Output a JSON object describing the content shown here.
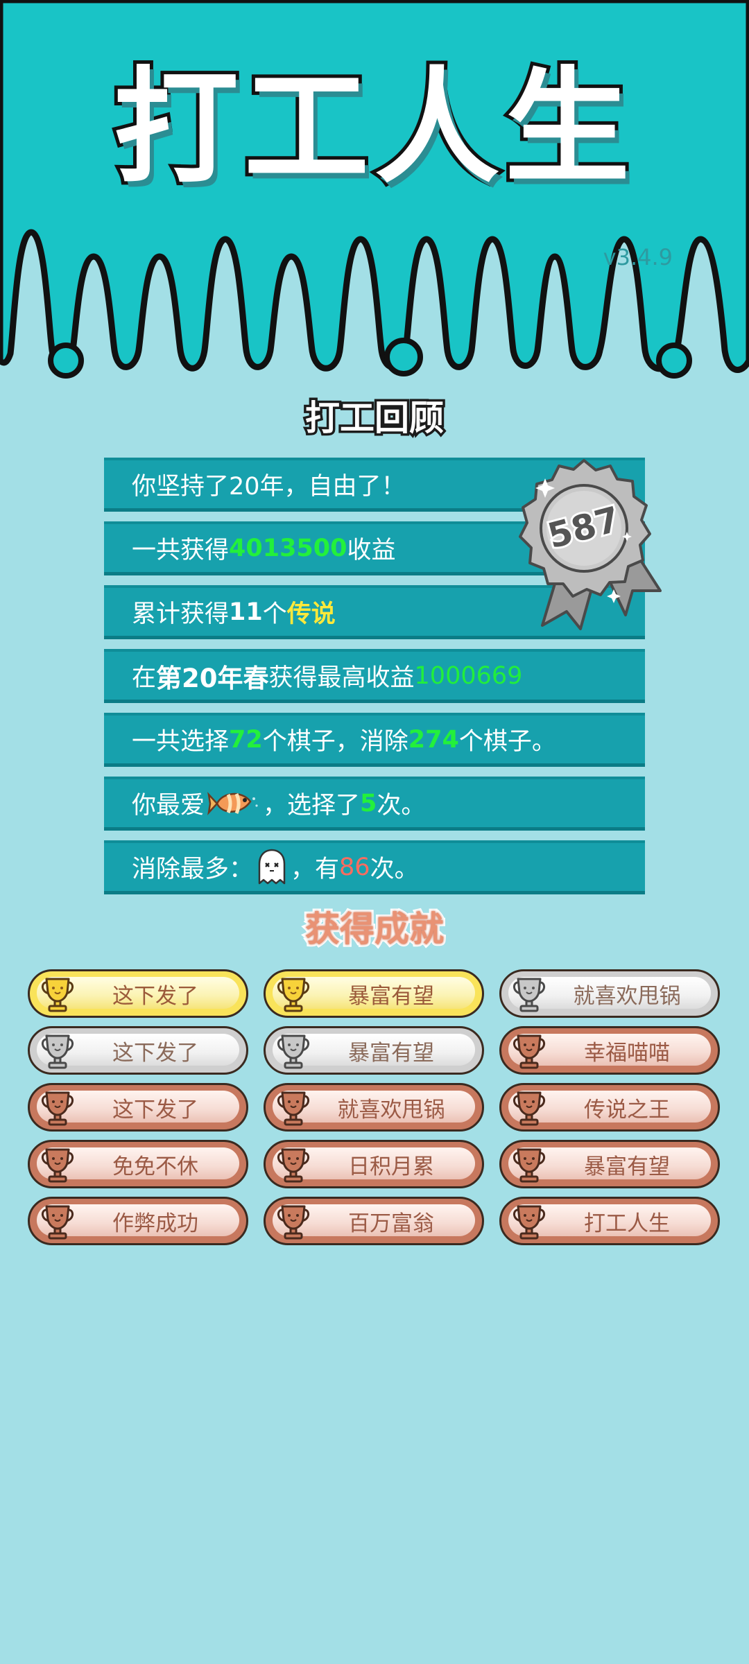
{
  "game": {
    "title": "打工人生",
    "version": "v3.4.9"
  },
  "review": {
    "title": "打工回顾",
    "badge_score": "587",
    "rows": [
      {
        "a": "你坚持了20年，自由了！"
      },
      {
        "a": "一共获得",
        "b": "4013500",
        "c": "收益"
      },
      {
        "a": "累计获得",
        "b": "11",
        "c": "个",
        "d": "传说"
      },
      {
        "a": "在 ",
        "b": "第20年春",
        "c": " 获得最高收益",
        "d": "1000669"
      },
      {
        "a": "一共选择",
        "b": "72",
        "c": "个棋子，消除",
        "d": "274",
        "e": "个棋子。"
      },
      {
        "a": "你最爱",
        "icon": "fish-icon",
        "b": "，选择了",
        "c": "5",
        "d": "次。"
      },
      {
        "a": "消除最多：",
        "icon": "ghost-icon",
        "b": "，有",
        "c": "86",
        "d": "次。"
      }
    ]
  },
  "achievements": {
    "title": "获得成就",
    "items": [
      {
        "label": "这下发了",
        "tier": "gold"
      },
      {
        "label": "暴富有望",
        "tier": "gold"
      },
      {
        "label": "就喜欢甩锅",
        "tier": "silver"
      },
      {
        "label": "这下发了",
        "tier": "silver"
      },
      {
        "label": "暴富有望",
        "tier": "silver"
      },
      {
        "label": "幸福喵喵",
        "tier": "bronze"
      },
      {
        "label": "这下发了",
        "tier": "bronze"
      },
      {
        "label": "就喜欢甩锅",
        "tier": "bronze"
      },
      {
        "label": "传说之王",
        "tier": "bronze"
      },
      {
        "label": "免免不休",
        "tier": "bronze"
      },
      {
        "label": "日积月累",
        "tier": "bronze"
      },
      {
        "label": "暴富有望",
        "tier": "bronze"
      },
      {
        "label": "作弊成功",
        "tier": "bronze"
      },
      {
        "label": "百万富翁",
        "tier": "bronze"
      },
      {
        "label": "打工人生",
        "tier": "bronze"
      }
    ]
  },
  "colors": {
    "header_teal": "#19c4c6",
    "background": "#a3dfe6",
    "row_bg": "#17a1ad",
    "highlight_green": "#23f03b",
    "highlight_yellow": "#ffe93a",
    "highlight_red": "#ff6c5f"
  }
}
